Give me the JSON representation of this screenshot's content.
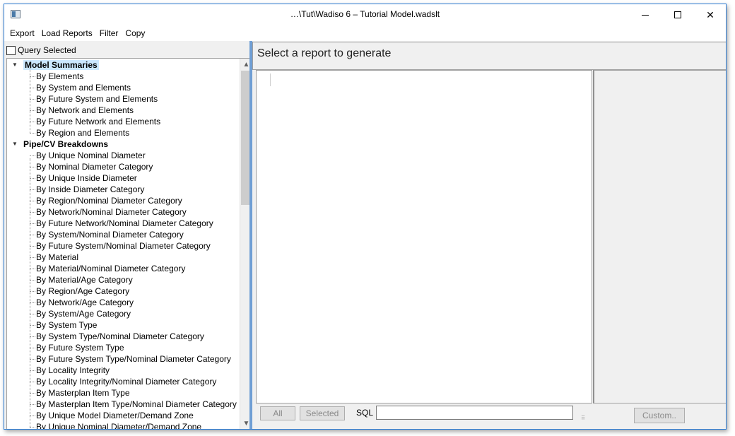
{
  "window": {
    "title": "…\\Tut\\Wadiso 6 – Tutorial Model.wadslt",
    "minimize_glyph": "",
    "close_glyph": "✕"
  },
  "menu": [
    "Export",
    "Load Reports",
    "Filter",
    "Copy"
  ],
  "query_selected_label": "Query Selected",
  "tree": {
    "groups": [
      {
        "label": "Model Summaries",
        "expanded": true,
        "selected": true,
        "items": [
          "By Elements",
          "By System and Elements",
          "By Future System and Elements",
          "By Network and Elements",
          "By Future Network and Elements",
          "By Region and Elements"
        ]
      },
      {
        "label": "Pipe/CV Breakdowns",
        "expanded": true,
        "selected": false,
        "items": [
          "By Unique Nominal Diameter",
          "By Nominal Diameter Category",
          "By Unique Inside Diameter",
          "By Inside Diameter Category",
          "By Region/Nominal Diameter Category",
          "By Network/Nominal Diameter Category",
          "By Future Network/Nominal Diameter Category",
          "By System/Nominal Diameter Category",
          "By Future System/Nominal Diameter Category",
          "By Material",
          "By Material/Nominal Diameter Category",
          "By Material/Age Category",
          "By Region/Age Category",
          "By Network/Age Category",
          "By System/Age Category",
          "By System Type",
          "By System Type/Nominal Diameter Category",
          "By Future System Type",
          "By Future System Type/Nominal Diameter Category",
          "By Locality Integrity",
          "By Locality Integrity/Nominal Diameter Category",
          "By Masterplan Item Type",
          "By Masterplan Item Type/Nominal Diameter Category",
          "By Unique Model Diameter/Demand Zone",
          "By Unique Nominal Diameter/Demand Zone"
        ]
      }
    ]
  },
  "header": {
    "text": "Select a report to generate"
  },
  "bottom": {
    "all_label": "All",
    "selected_label": "Selected",
    "sql_label": "SQL",
    "sql_value": "",
    "custom_label": "Custom.."
  }
}
